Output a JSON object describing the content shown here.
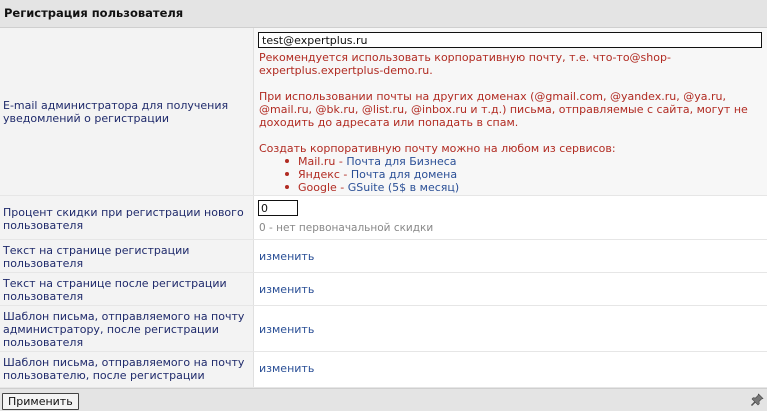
{
  "header": {
    "title": "Регистрация пользователя"
  },
  "email_row": {
    "label_lines": [
      "E-mail администратора для получения",
      "уведомлений о регистрации"
    ],
    "value": "test@expertplus.ru",
    "note1": [
      "Рекомендуется использовать корпоративную почту, т.е. что-то@shop-",
      "expertplus.expertplus-demo.ru."
    ],
    "note2": [
      "При использовании почты на других доменах (@gmail.com, @yandex.ru, @ya.ru,",
      "@mail.ru, @bk.ru, @list.ru, @inbox.ru и т.д.) письма, отправляемые с сайта, могут не",
      "доходить до адресата или попадать в спам."
    ],
    "services_intro": "Создать корпоративную почту можно на любом из сервисов:",
    "services": [
      {
        "name": "Mail.ru",
        "sep": " - ",
        "link": "Почта для Бизнеса"
      },
      {
        "name": "Яндекс",
        "sep": " - ",
        "link": "Почта для домена"
      },
      {
        "name": "Google",
        "sep": " - ",
        "link": "GSuite (5$ в месяц)"
      }
    ]
  },
  "discount_row": {
    "label_lines": [
      "Процент скидки при регистрации нового",
      "пользователя"
    ],
    "value": "0",
    "hint": "0 - нет первоначальной скидки"
  },
  "reg_text_row": {
    "label_lines": [
      "Текст на странице регистрации",
      "пользователя"
    ],
    "link": "изменить"
  },
  "after_reg_text_row": {
    "label_lines": [
      "Текст на странице после регистрации",
      "пользователя"
    ],
    "link": "изменить"
  },
  "admin_mail_row": {
    "label_lines": [
      "Шаблон письма, отправляемого на почту",
      "администратору, после регистрации",
      "пользователя"
    ],
    "link": "изменить"
  },
  "user_mail_row": {
    "label_lines": [
      "Шаблон письма, отправляемого на почту",
      "пользователю, после регистрации"
    ],
    "link": "изменить"
  },
  "footer": {
    "apply_label": "Применить",
    "pin_icon": "pin-icon"
  },
  "colors": {
    "label_text": "#1f2a6b",
    "warning": "#b12b22",
    "link": "#2a4f96",
    "header_bg": "#e4e4e4"
  }
}
